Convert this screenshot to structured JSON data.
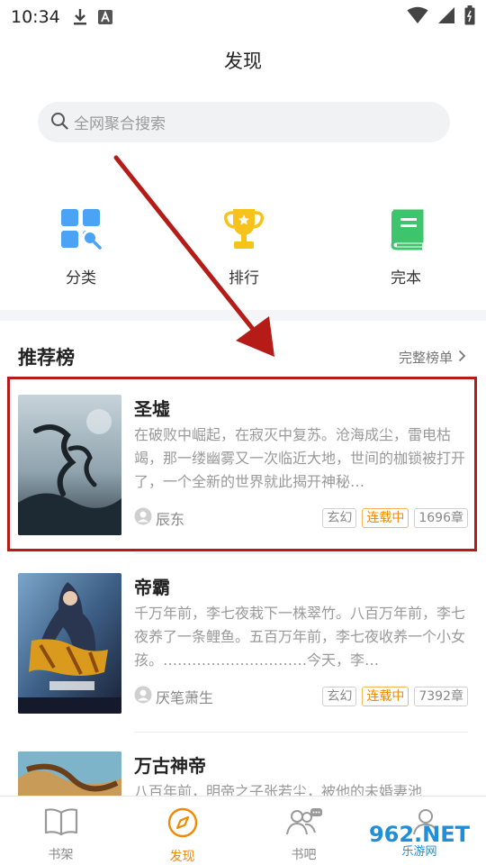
{
  "status_bar": {
    "time": "10:34"
  },
  "header": {
    "title": "发现"
  },
  "search": {
    "placeholder": "全网聚合搜索"
  },
  "entries": [
    {
      "label": "分类",
      "icon": "category-grid-icon",
      "color": "#4aa3f5"
    },
    {
      "label": "排行",
      "icon": "trophy-icon",
      "color": "#f7c21a"
    },
    {
      "label": "完本",
      "icon": "book-icon",
      "color": "#3ec46d"
    }
  ],
  "section": {
    "title": "推荐榜",
    "more": "完整榜单"
  },
  "books": [
    {
      "title": "圣墟",
      "desc": "在破败中崛起，在寂灭中复苏。沧海成尘，雷电枯竭，那一缕幽雾又一次临近大地，世间的枷锁被打开了，一个全新的世界就此揭开神秘…",
      "author": "辰东",
      "genre": "玄幻",
      "status": "连载中",
      "chapters": "1696章"
    },
    {
      "title": "帝霸",
      "desc": "千万年前，李七夜栽下一株翠竹。八百万年前，李七夜养了一条鲤鱼。五百万年前，李七夜收养一个小女孩。…………………………今天，李…",
      "author": "厌笔萧生",
      "genre": "玄幻",
      "status": "连载中",
      "chapters": "7392章"
    },
    {
      "title": "万古神帝",
      "desc": "八百年前，明帝之子张若尘，被他的未婚妻池"
    }
  ],
  "bottom_nav": [
    {
      "label": "书架",
      "icon": "bookshelf-icon"
    },
    {
      "label": "发现",
      "icon": "compass-icon",
      "active": true
    },
    {
      "label": "书吧",
      "icon": "community-icon"
    },
    {
      "label": "",
      "icon": "profile-icon"
    }
  ],
  "watermark": {
    "main": "962.NET",
    "sub": "乐游网"
  },
  "colors": {
    "accent": "#f08a00",
    "highlight": "#b51c17"
  }
}
